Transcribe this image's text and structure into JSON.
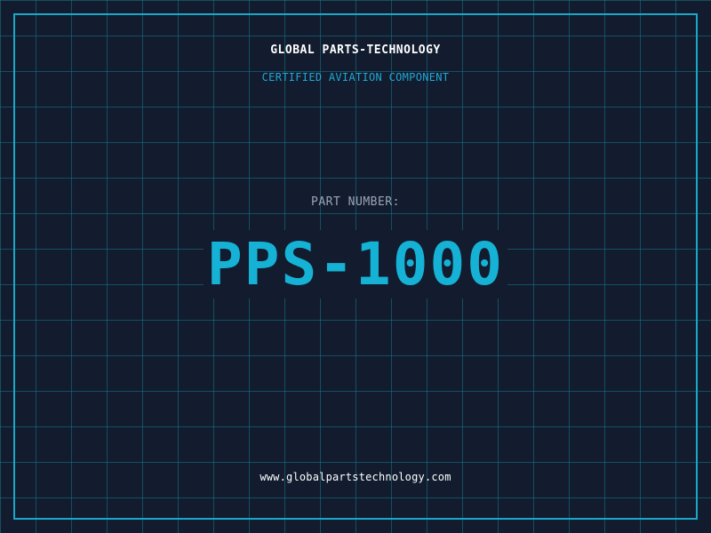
{
  "company_name": "GLOBAL PARTS-TECHNOLOGY",
  "subtitle": "CERTIFIED AVIATION COMPONENT",
  "part_label": "PART NUMBER:",
  "part_number": "PPS-1000",
  "website": "www.globalpartstechnology.com",
  "colors": {
    "background": "#121c2e",
    "grid": "#16788a",
    "frame": "#18a8c8",
    "accent": "#15b2d6",
    "subtitle": "#21a7d4",
    "label": "#9aa6b6",
    "text": "#ffffff"
  }
}
